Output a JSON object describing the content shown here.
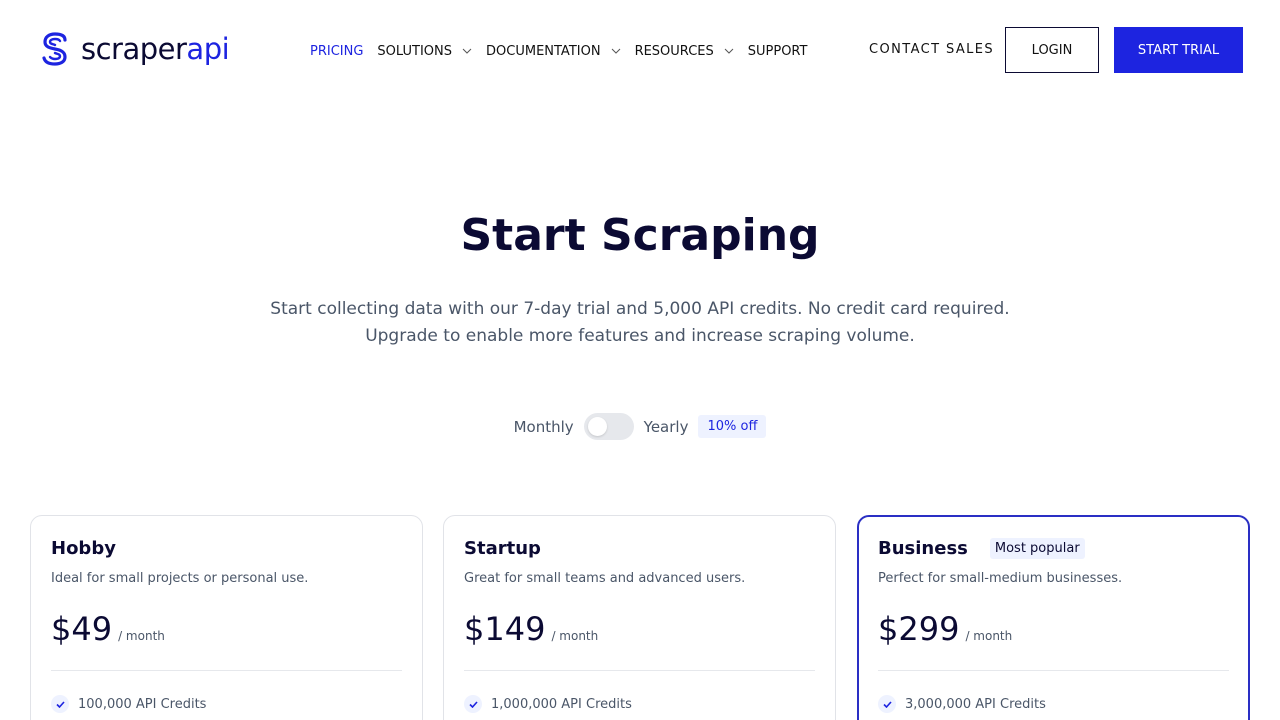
{
  "brand": {
    "name_part1": "scraper",
    "name_part2": "api",
    "color": "#1d24e0"
  },
  "nav": {
    "items": [
      {
        "label": "PRICING",
        "active": true,
        "dropdown": false
      },
      {
        "label": "SOLUTIONS",
        "active": false,
        "dropdown": true
      },
      {
        "label": "DOCUMENTATION",
        "active": false,
        "dropdown": true
      },
      {
        "label": "RESOURCES",
        "active": false,
        "dropdown": true
      },
      {
        "label": "SUPPORT",
        "active": false,
        "dropdown": false
      }
    ],
    "contact_sales": "CONTACT SALES",
    "login": "LOGIN",
    "start_trial": "START TRIAL"
  },
  "hero": {
    "title": "Start Scraping",
    "subtitle_line1": "Start collecting data with our 7-day trial and 5,000 API credits. No credit card required.",
    "subtitle_line2": "Upgrade to enable more features and increase scraping volume."
  },
  "billing": {
    "monthly_label": "Monthly",
    "yearly_label": "Yearly",
    "discount_badge": "10% off",
    "yearly_selected": false
  },
  "plans": [
    {
      "name": "Hobby",
      "description": "Ideal for small projects or personal use.",
      "price": "$49",
      "period": "/ month",
      "features": [
        "100,000 API Credits"
      ],
      "badge": ""
    },
    {
      "name": "Startup",
      "description": "Great for small teams and advanced users.",
      "price": "$149",
      "period": "/ month",
      "features": [
        "1,000,000 API Credits"
      ],
      "badge": ""
    },
    {
      "name": "Business",
      "description": "Perfect for small-medium businesses.",
      "price": "$299",
      "period": "/ month",
      "features": [
        "3,000,000 API Credits"
      ],
      "badge": "Most popular"
    }
  ],
  "icons": {
    "logo": "scraperapi-logo-icon",
    "chevron": "chevron-down-icon",
    "check": "check-icon"
  }
}
